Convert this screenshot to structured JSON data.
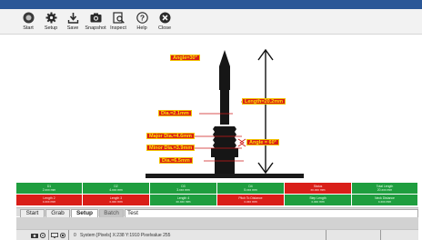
{
  "toolbar": {
    "items": [
      {
        "label": "Start",
        "icon": "start-icon"
      },
      {
        "label": "Setup",
        "icon": "gear-icon"
      },
      {
        "label": "Save",
        "icon": "save-icon"
      },
      {
        "label": "Snapshot",
        "icon": "camera-icon"
      },
      {
        "label": "Inspect",
        "icon": "inspect-icon"
      },
      {
        "label": "Help",
        "icon": "help-icon"
      },
      {
        "label": "Close",
        "icon": "close-icon"
      }
    ]
  },
  "overlays": {
    "angle_top": "Angle=30°",
    "length": "Length=20.2mm",
    "dia_upper": "Dia.=2.1mm",
    "major_dia": "Major Dia.=4.6mm",
    "minor_dia": "Minor Dia.=3.9mm",
    "angle_thread": "Angle = 60°",
    "dia_lower": "Dia.=6.5mm"
  },
  "measurements": [
    {
      "top": "D1",
      "bottom": "2.xxx mm",
      "status": "pass"
    },
    {
      "top": "D2",
      "bottom": "4.xxx mm",
      "status": "pass"
    },
    {
      "top": "D3",
      "bottom": "3.xxx mm",
      "status": "pass"
    },
    {
      "top": "D4",
      "bottom": "5.xxx mm",
      "status": "pass"
    },
    {
      "top": "Status",
      "bottom": "xx.xxx mm",
      "status": "fail"
    },
    {
      "top": "Total Length",
      "bottom": "20.xxx mm",
      "status": "pass"
    },
    {
      "top": "Length 2",
      "bottom": "x.xxx mm",
      "status": "fail"
    },
    {
      "top": "Length 3",
      "bottom": "x.xxx mm",
      "status": "fail"
    },
    {
      "top": "Length 4",
      "bottom": "xx.xxx mm",
      "status": "pass"
    },
    {
      "top": "Pitch To Distance",
      "bottom": "x.xxx mm",
      "status": "fail"
    },
    {
      "top": "Step Length",
      "bottom": "x.xxx mm",
      "status": "pass"
    },
    {
      "top": "Neck Distance",
      "bottom": "x.xxx mm",
      "status": "pass"
    }
  ],
  "tabs": [
    "Start",
    "Grab",
    "Setup",
    "Batch",
    "Test"
  ],
  "status_bar": {
    "code": "0",
    "text": "System [Pixels] X:238 Y:1910 Pixelvalue 255"
  },
  "colors": {
    "pass": "#1f9e3f",
    "fail": "#d91e18",
    "label_bg": "#d91e18",
    "label_text": "#ffe400",
    "title_bar": "#2b5797"
  }
}
